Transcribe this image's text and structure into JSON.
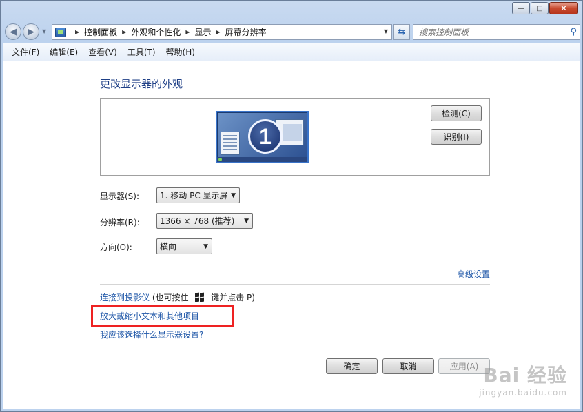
{
  "window": {
    "minimize": "—",
    "maximize": "□",
    "close": "✕"
  },
  "address": {
    "breadcrumbs": [
      "控制面板",
      "外观和个性化",
      "显示",
      "屏幕分辨率"
    ]
  },
  "search": {
    "placeholder": "搜索控制面板"
  },
  "menu": {
    "items": [
      "文件(F)",
      "编辑(E)",
      "查看(V)",
      "工具(T)",
      "帮助(H)"
    ]
  },
  "main": {
    "title": "更改显示器的外观",
    "monitor_number": "1",
    "detect_button": "检测(C)",
    "identify_button": "识别(I)",
    "display_label": "显示器(S):",
    "display_value": "1. 移动 PC 显示屏",
    "resolution_label": "分辨率(R):",
    "resolution_value": "1366 × 768 (推荐)",
    "orientation_label": "方向(O):",
    "orientation_value": "横向",
    "advanced_link": "高级设置",
    "projector_link": "连接到投影仪",
    "projector_hint_pre": "(也可按住",
    "projector_hint_post": "键并点击 P)",
    "text_size_link": "放大或缩小文本和其他项目",
    "which_settings_link": "我应该选择什么显示器设置?"
  },
  "footer": {
    "ok": "确定",
    "cancel": "取消",
    "apply": "应用(A)"
  },
  "watermark": {
    "main": "Bai 经验",
    "sub": "jingyan.baidu.com"
  },
  "colors": {
    "link": "#1f57a8",
    "title": "#1e3f86",
    "highlight": "#ee2222"
  }
}
